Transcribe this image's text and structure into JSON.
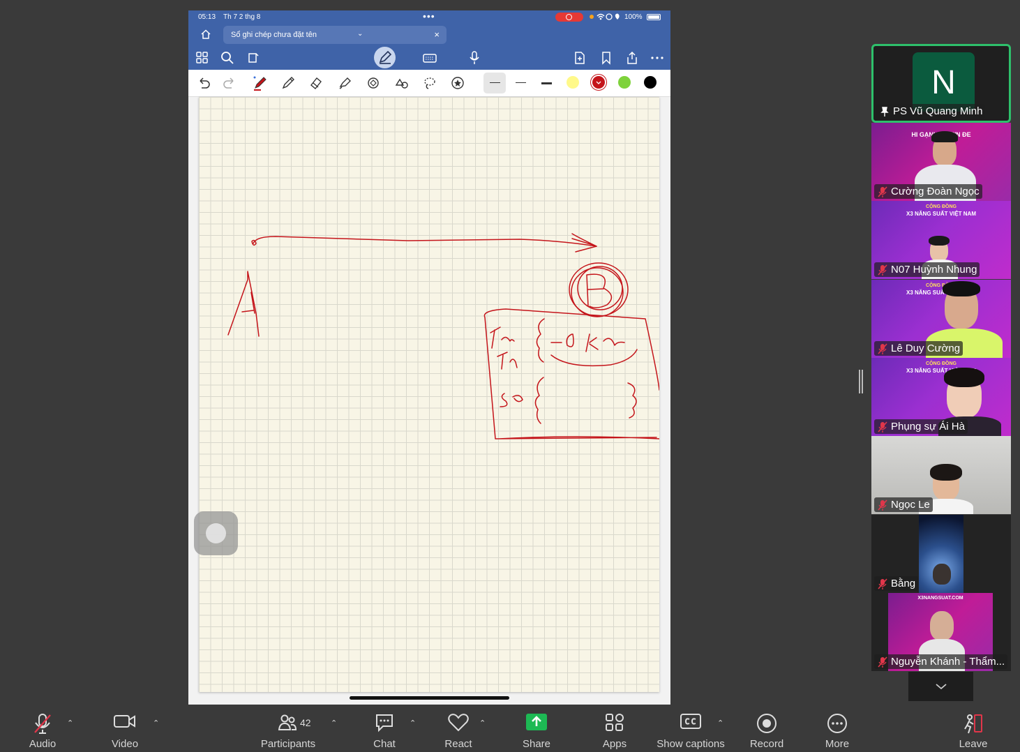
{
  "ipad": {
    "time": "05:13",
    "date": "Th 7 2 thg 8",
    "battery": "100%",
    "tab_title": "Sổ ghi chép chưa đặt tên",
    "tab_close": "×",
    "tab_chevron": "⌄"
  },
  "pen_colors": [
    "#fff98a",
    "#c4141a",
    "#7ed23b",
    "#000000"
  ],
  "ink_color": "#c4141a",
  "participants": [
    {
      "name": "PS Vũ Quang Minh",
      "initial": "N",
      "pinned": true
    },
    {
      "name": "Cường Đoàn Ngọc",
      "muted": true
    },
    {
      "name": "N07 Huỳnh Nhung",
      "muted": true
    },
    {
      "name": "Lê Duy Cường",
      "muted": true
    },
    {
      "name": "Phụng sự Ái Hà",
      "muted": true
    },
    {
      "name": "Ngọc Le",
      "muted": true
    },
    {
      "name": "Bằng",
      "muted": true
    },
    {
      "name": "Nguyễn Khánh - Thẩm...",
      "muted": true
    }
  ],
  "tile_banners": {
    "cuong_doan": "HI GẠNH U          ẠƠN ĐE",
    "community_1": "CỘNG ĐỒNG",
    "community_2": "X3 NĂNG SUẤT VIỆT NAM",
    "website": "X3NANGSUAT.COM"
  },
  "controls": {
    "audio": "Audio",
    "video": "Video",
    "participants": "Participants",
    "participants_count": "42",
    "chat": "Chat",
    "react": "React",
    "share": "Share",
    "apps": "Apps",
    "captions": "Show captions",
    "record": "Record",
    "more": "More",
    "leave": "Leave"
  },
  "accent": {
    "share_green": "#1db954",
    "leave_red": "#e0364a",
    "pin_border": "#2ec06b"
  }
}
